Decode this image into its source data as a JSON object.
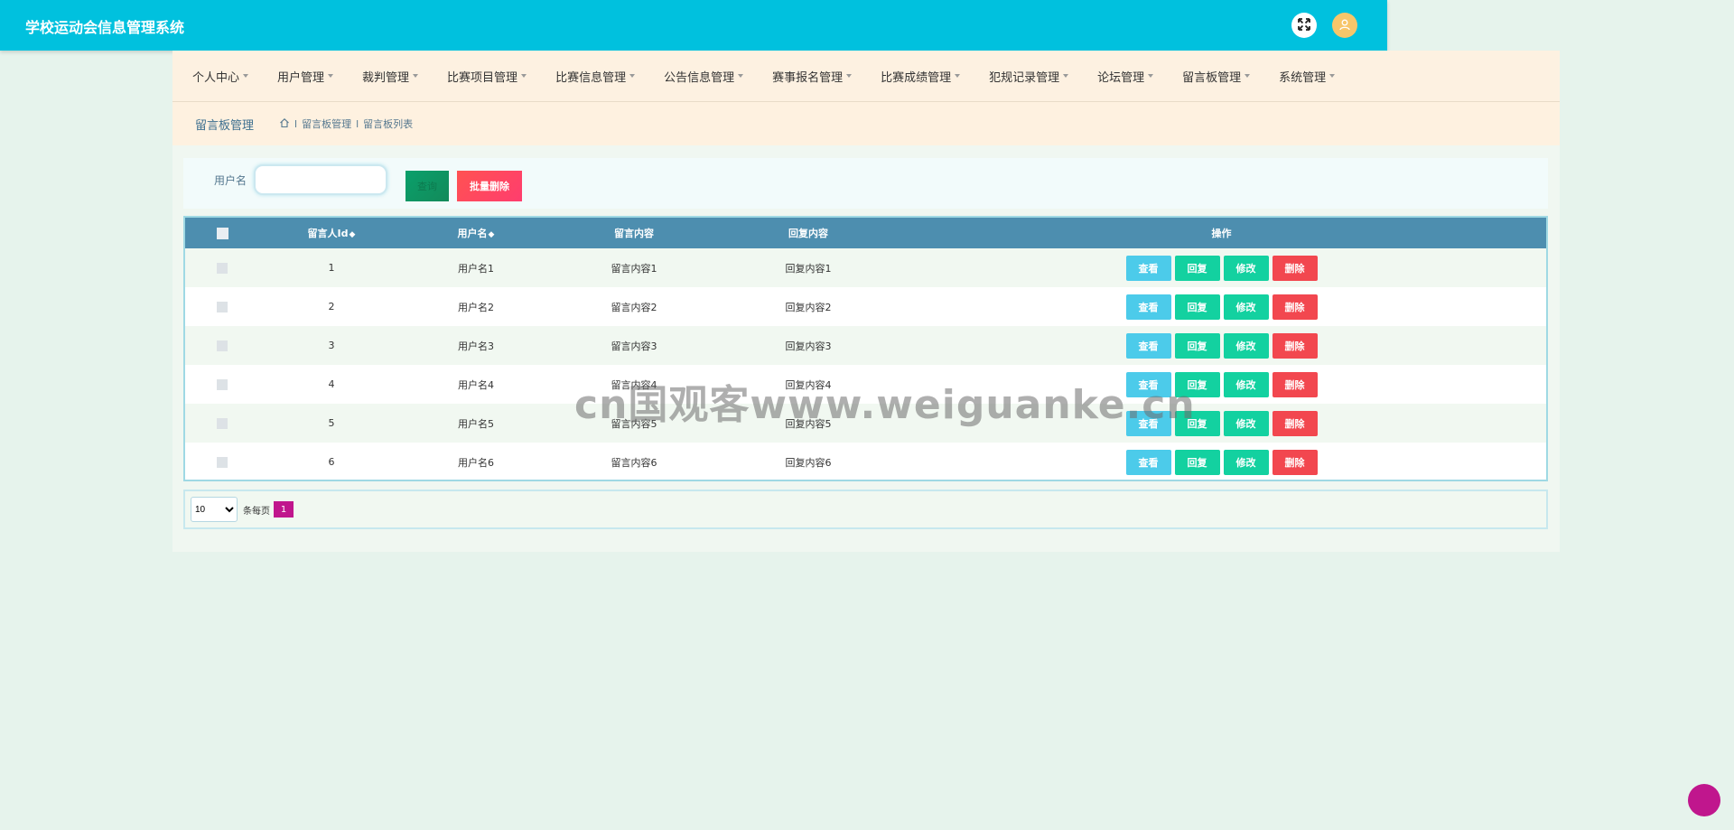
{
  "app": {
    "title": "学校运动会信息管理系统"
  },
  "header": {
    "fullscreen_icon": "expand-arrows-icon",
    "avatar_icon": "user-icon"
  },
  "nav": {
    "items": [
      {
        "label": "个人中心"
      },
      {
        "label": "用户管理"
      },
      {
        "label": "裁判管理"
      },
      {
        "label": "比赛项目管理"
      },
      {
        "label": "比赛信息管理"
      },
      {
        "label": "公告信息管理"
      },
      {
        "label": "赛事报名管理"
      },
      {
        "label": "比赛成绩管理"
      },
      {
        "label": "犯规记录管理"
      },
      {
        "label": "论坛管理"
      },
      {
        "label": "留言板管理"
      },
      {
        "label": "系统管理"
      }
    ]
  },
  "breadcrumb": {
    "title": "留言板管理",
    "home_icon": "home-icon",
    "separator": "l",
    "items": [
      "留言板管理",
      "留言板列表"
    ]
  },
  "search": {
    "label": "用户名",
    "value": "",
    "placeholder": "",
    "search_button": "查询",
    "batch_delete_button": "批量删除"
  },
  "table": {
    "columns": [
      "留言人Id",
      "用户名",
      "留言内容",
      "回复内容",
      "操作"
    ],
    "sort_mark": "◆",
    "rows": [
      {
        "id": "1",
        "username": "用户名1",
        "content": "留言内容1",
        "reply": "回复内容1"
      },
      {
        "id": "2",
        "username": "用户名2",
        "content": "留言内容2",
        "reply": "回复内容2"
      },
      {
        "id": "3",
        "username": "用户名3",
        "content": "留言内容3",
        "reply": "回复内容3"
      },
      {
        "id": "4",
        "username": "用户名4",
        "content": "留言内容4",
        "reply": "回复内容4"
      },
      {
        "id": "5",
        "username": "用户名5",
        "content": "留言内容5",
        "reply": "回复内容5"
      },
      {
        "id": "6",
        "username": "用户名6",
        "content": "留言内容6",
        "reply": "回复内容6"
      }
    ],
    "actions": {
      "view": "查看",
      "reply": "回复",
      "edit": "修改",
      "delete": "删除"
    }
  },
  "pager": {
    "page_size": "10",
    "page_size_options": [
      "10"
    ],
    "page_size_label": "条每页",
    "current_page": "1"
  },
  "watermark": {
    "text": "cn国观客www.weiguanke.cn"
  },
  "colors": {
    "topbar": "#00c1de",
    "table_header": "#4d8eaf",
    "view_button": "#4ccbea",
    "reply_edit_button": "#13d1a0",
    "delete_button": "#f2474f",
    "page_active": "#c0168d"
  }
}
